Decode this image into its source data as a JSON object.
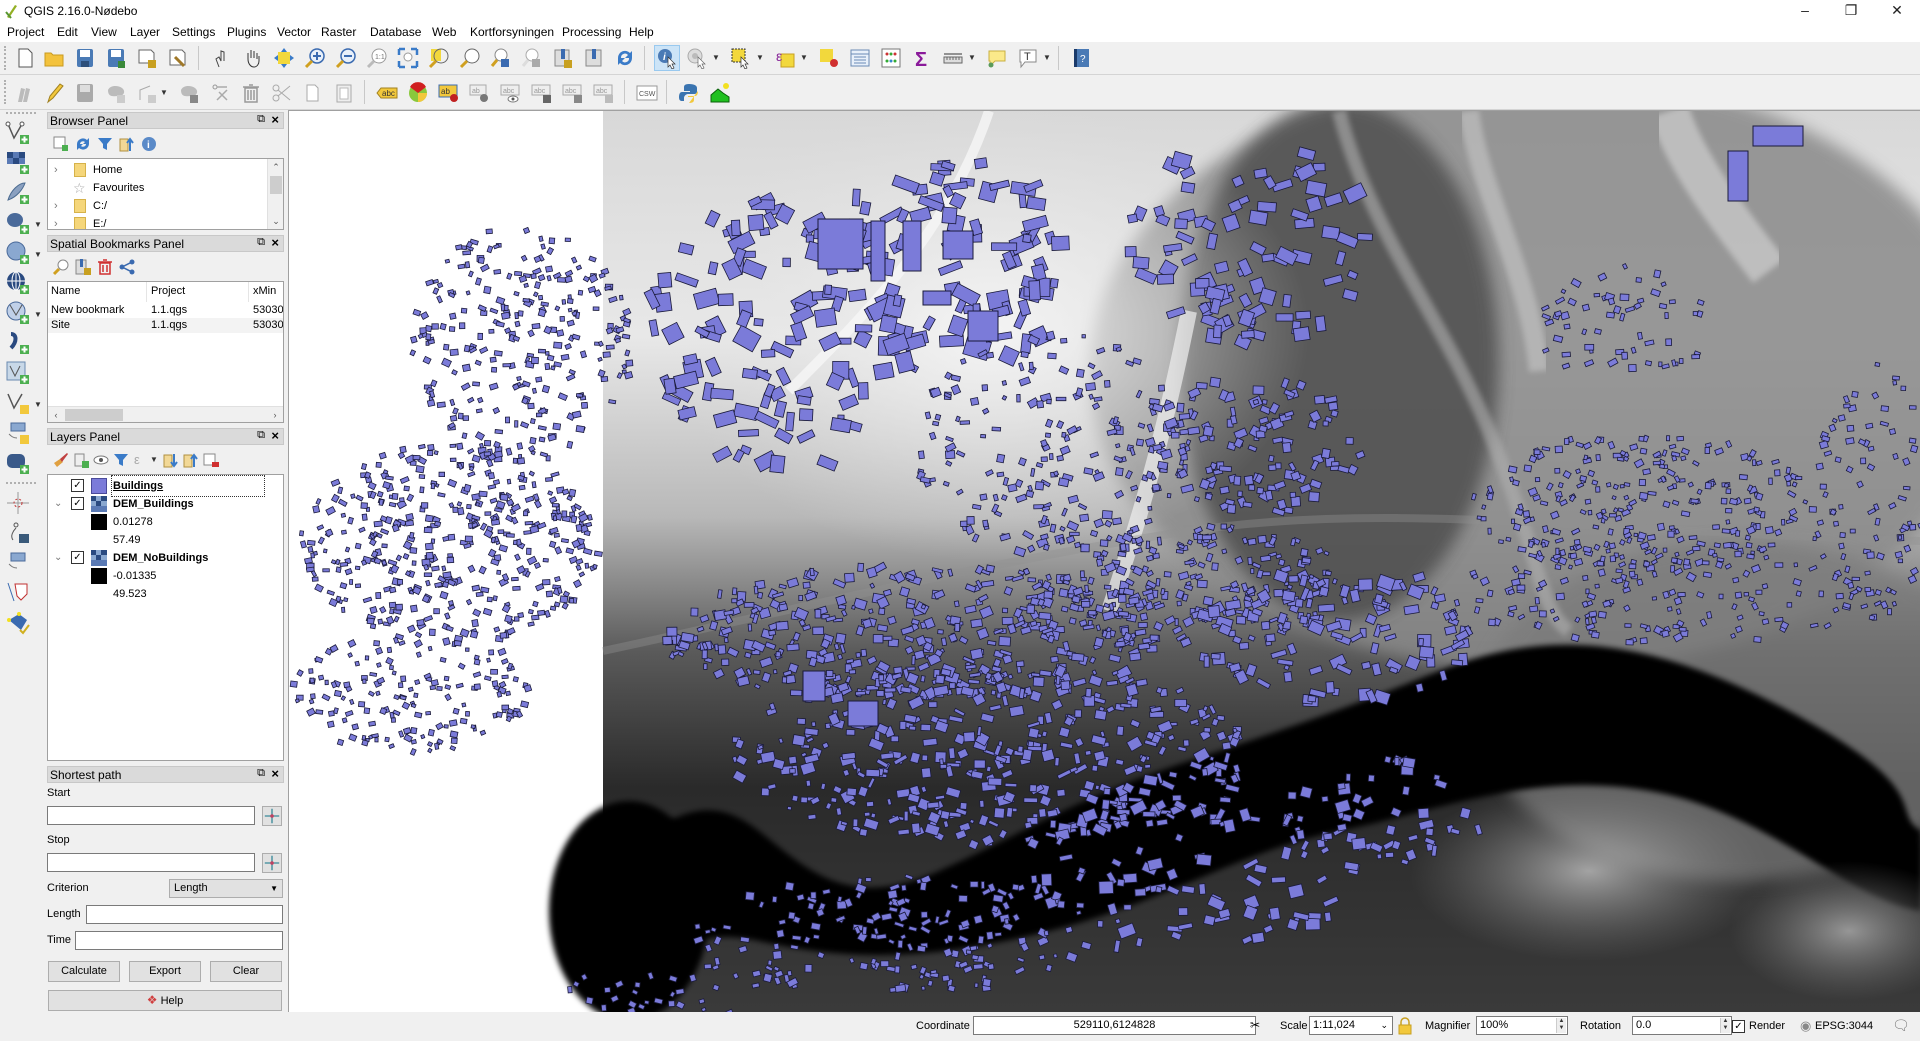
{
  "window": {
    "title": "QGIS 2.16.0-Nødebo",
    "controls": [
      "minimize",
      "restore",
      "close"
    ]
  },
  "menubar": {
    "items": [
      {
        "label": "Project",
        "accel": "j"
      },
      {
        "label": "Edit",
        "accel": "E"
      },
      {
        "label": "View",
        "accel": "V"
      },
      {
        "label": "Layer",
        "accel": "L"
      },
      {
        "label": "Settings",
        "accel": "S"
      },
      {
        "label": "Plugins",
        "accel": "P"
      },
      {
        "label": "Vector",
        "accel": "o"
      },
      {
        "label": "Raster",
        "accel": "R"
      },
      {
        "label": "Database",
        "accel": "D"
      },
      {
        "label": "Web",
        "accel": "W"
      },
      {
        "label": "Kortforsyningen",
        "accel": ""
      },
      {
        "label": "Processing",
        "accel": "c"
      },
      {
        "label": "Help",
        "accel": "H"
      }
    ]
  },
  "toolbar1": {
    "icons": [
      "new-project-icon",
      "open-project-icon",
      "save-project-icon",
      "save-as-icon",
      "new-print-composer-icon",
      "composer-manager-icon",
      "touch-zoom-icon",
      "pan-icon",
      "pan-to-selection-icon",
      "zoom-in-icon",
      "zoom-out-icon",
      "zoom-native-icon",
      "zoom-full-icon",
      "zoom-to-selection-icon",
      "zoom-to-layer-icon",
      "zoom-last-icon",
      "zoom-next-icon",
      "new-bookmark-icon",
      "show-bookmarks-icon",
      "refresh-icon",
      "identify-icon",
      "run-action-icon",
      "select-feature-icon",
      "select-by-expression-icon",
      "deselect-all-icon",
      "attribute-table-icon",
      "field-calculator-icon",
      "statistics-icon",
      "measure-icon",
      "map-tips-icon",
      "text-annotation-icon",
      "help-contents-icon"
    ]
  },
  "toolbar2": {
    "icons": [
      "current-edits-icon",
      "toggle-editing-icon",
      "save-edits-icon",
      "add-feature-icon",
      "node-tool-icon",
      "move-feature-icon",
      "delete-part-icon",
      "delete-selected-icon",
      "cut-features-icon",
      "copy-features-icon",
      "paste-features-icon",
      "layer-labeling-icon",
      "diagram-icon",
      "pin-labels-icon",
      "highlight-pinned-icon",
      "show-hide-labels-icon",
      "move-label-icon",
      "rotate-label-icon",
      "change-label-icon",
      "csw-icon",
      "python-console-icon",
      "profile-tool-icon"
    ],
    "csw_label": "CSW"
  },
  "browser_panel": {
    "title": "Browser Panel",
    "items": [
      {
        "label": "Home",
        "icon": "folder-icon",
        "expandable": true
      },
      {
        "label": "Favourites",
        "icon": "star-icon",
        "expandable": false
      },
      {
        "label": "C:/",
        "icon": "folder-icon",
        "expandable": true
      },
      {
        "label": "E:/",
        "icon": "folder-icon",
        "expandable": true
      }
    ]
  },
  "bookmarks_panel": {
    "title": "Spatial Bookmarks Panel",
    "columns": [
      "Name",
      "Project",
      "xMin"
    ],
    "rows": [
      [
        "New bookmark",
        "1.1.qgs",
        "53030"
      ],
      [
        "Site",
        "1.1.qgs",
        "53030"
      ]
    ]
  },
  "layers_panel": {
    "title": "Layers Panel",
    "layers": [
      {
        "name": "Buildings",
        "checked": true,
        "type": "vector",
        "color": "#7b7bd9",
        "selected": true
      },
      {
        "name": "DEM_Buildings",
        "checked": true,
        "type": "raster",
        "expanded": true,
        "min": "0.01278",
        "max": "57.49"
      },
      {
        "name": "DEM_NoBuildings",
        "checked": true,
        "type": "raster",
        "expanded": true,
        "min": "-0.01335",
        "max": "49.523"
      }
    ]
  },
  "shortest_path": {
    "title": "Shortest path",
    "start_label": "Start",
    "start_value": "",
    "stop_label": "Stop",
    "stop_value": "",
    "criterion_label": "Criterion",
    "criterion_value": "Length",
    "length_label": "Length",
    "length_value": "",
    "time_label": "Time",
    "time_value": "",
    "calculate": "Calculate",
    "export": "Export",
    "clear": "Clear",
    "help": "Help"
  },
  "map": {
    "building_color": "#7b7bd9",
    "building_outline": "#1a1a3a"
  },
  "statusbar": {
    "coordinate_label": "Coordinate",
    "coordinate_value": "529110,6124828",
    "scale_label": "Scale",
    "scale_value": "1:11,024",
    "magnifier_label": "Magnifier",
    "magnifier_value": "100%",
    "rotation_label": "Rotation",
    "rotation_value": "0.0",
    "render_label": "Render",
    "render_checked": true,
    "crs": "EPSG:3044"
  }
}
